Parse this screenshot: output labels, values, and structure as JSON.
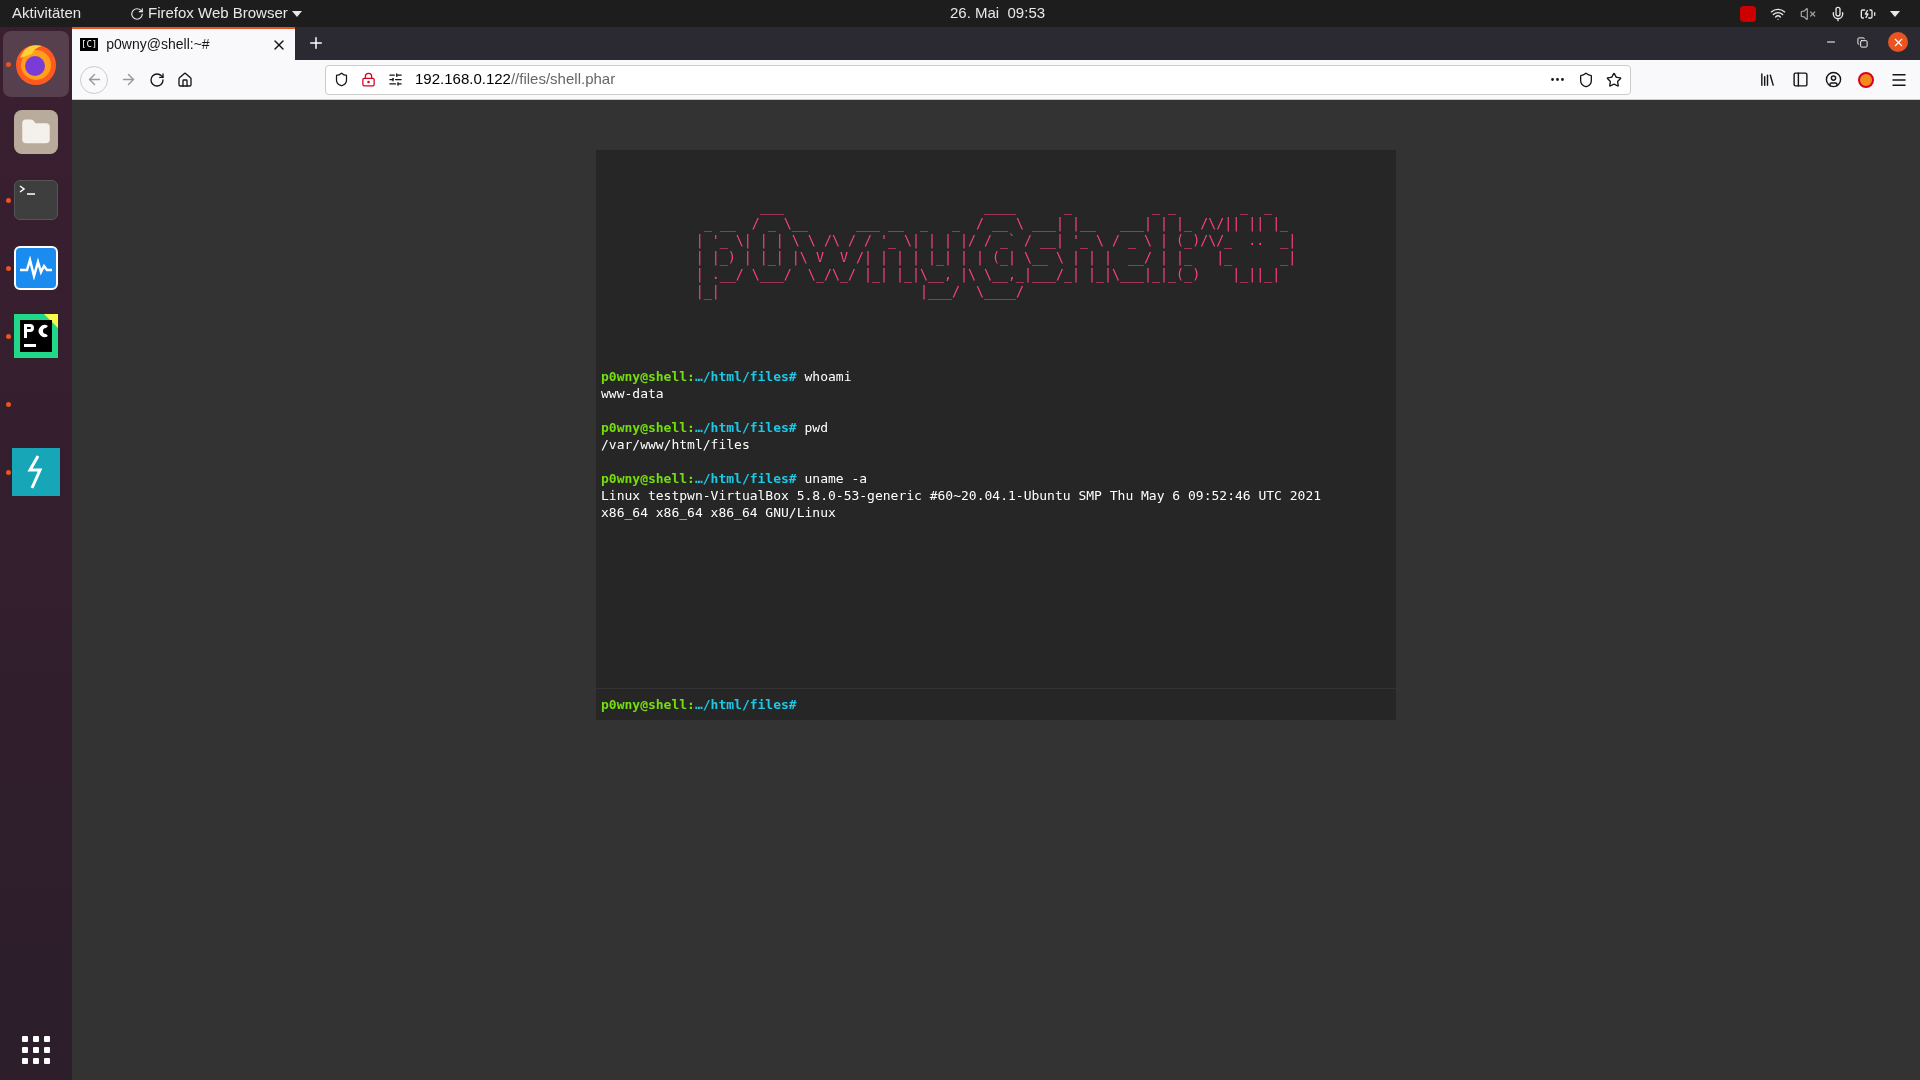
{
  "top_bar": {
    "activities": "Aktivitäten",
    "app_menu": "Firefox Web Browser",
    "clock": "26. Mai  09:53"
  },
  "dock": {
    "items": [
      {
        "kind": "firefox",
        "running": true,
        "selected": true
      },
      {
        "kind": "files",
        "running": false,
        "selected": false
      },
      {
        "kind": "terminal",
        "running": true,
        "selected": false
      },
      {
        "kind": "monitor",
        "running": true,
        "selected": false
      },
      {
        "kind": "pycharm",
        "running": true,
        "selected": false
      },
      {
        "kind": "blank",
        "running": true,
        "selected": false
      },
      {
        "kind": "bolt",
        "running": true,
        "selected": false
      }
    ]
  },
  "browser": {
    "tabs": [
      {
        "title": "p0wny@shell:~#",
        "icon": "[C]",
        "selected": true
      }
    ],
    "url_host": "192.168.0.122",
    "url_path": "//files/shell.phar"
  },
  "terminal": {
    "banner": "        ___                         ____      _          _ _        _  _   \n _ __  / _ \\__      ___ __  _   _  / __ \\ ___| |__   ___| | |_ /\\/|| || |_ \n| '_ \\| | | \\ \\ /\\ / / '_ \\| | | |/ / _` / __| '_ \\ / _ \\ | (_)/\\/_  ..  _|\n| |_) | |_| |\\ V  V /| | | | |_| | | (_| \\__ \\ | | |  __/ | |_   |_      _|\n| .__/ \\___/  \\_/\\_/ |_| |_|\\__, |\\ \\__,_|___/_| |_|\\___|_|_(_)    |_||_|  \n|_|                         |___/  \\____/                                  ",
    "history": [
      {
        "user": "p0wny@shell:",
        "path": "…/html/files#",
        "command": "whoami",
        "output": [
          "www-data"
        ]
      },
      {
        "user": "p0wny@shell:",
        "path": "…/html/files#",
        "command": "pwd",
        "output": [
          "/var/www/html/files"
        ]
      },
      {
        "user": "p0wny@shell:",
        "path": "…/html/files#",
        "command": "uname -a",
        "output": [
          "Linux testpwn-VirtualBox 5.8.0-53-generic #60~20.04.1-Ubuntu SMP Thu May 6 09:52:46 UTC 2021",
          "x86_64 x86_64 x86_64 GNU/Linux"
        ]
      }
    ],
    "prompt": {
      "user": "p0wny@shell:",
      "path": "…/html/files#"
    }
  }
}
